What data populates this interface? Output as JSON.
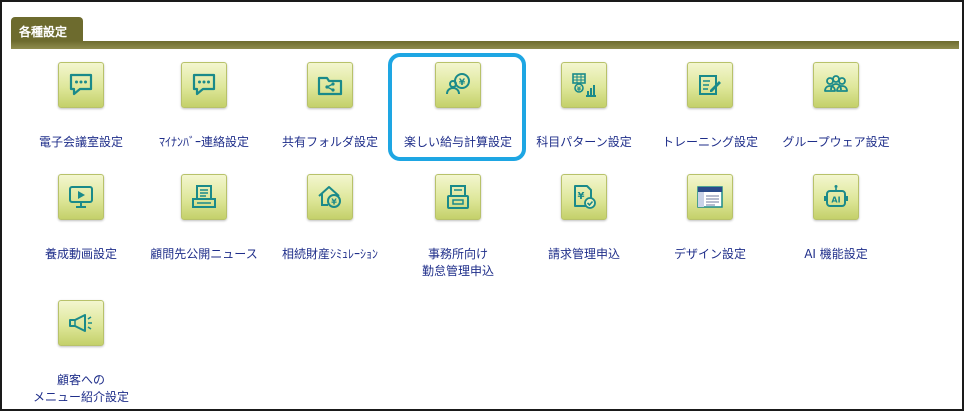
{
  "tab": {
    "label": "各種設定"
  },
  "colors": {
    "accent": "#6d6b2e",
    "highlight": "#1ea6e3",
    "link": "#1f2e8a"
  },
  "items": [
    {
      "label": "電子会議室設定",
      "icon": "chat-bubble-icon"
    },
    {
      "label": "ﾏｲﾅﾝﾊﾞｰ連絡設定",
      "icon": "chat-bubble-icon"
    },
    {
      "label": "共有フォルダ設定",
      "icon": "shared-folder-icon"
    },
    {
      "label": "楽しい給与計算設定",
      "icon": "payroll-icon"
    },
    {
      "label": "科目パターン設定",
      "icon": "account-chart-icon"
    },
    {
      "label": "トレーニング設定",
      "icon": "training-icon"
    },
    {
      "label": "グループウェア設定",
      "icon": "group-icon"
    },
    {
      "label": "養成動画設定",
      "icon": "video-icon"
    },
    {
      "label": "顧問先公開ニュース",
      "icon": "news-icon"
    },
    {
      "label": "相続財産ｼﾐｭﾚｰｼｮﾝ",
      "icon": "inheritance-icon"
    },
    {
      "label": "事務所向け",
      "label2": "勤怠管理申込",
      "icon": "attendance-icon"
    },
    {
      "label": "請求管理申込",
      "icon": "billing-icon"
    },
    {
      "label": "デザイン設定",
      "icon": "design-icon"
    },
    {
      "label": "AI 機能設定",
      "icon": "ai-icon"
    },
    {
      "label": "顧客への",
      "label2": "メニュー紹介設定",
      "icon": "megaphone-icon"
    }
  ]
}
